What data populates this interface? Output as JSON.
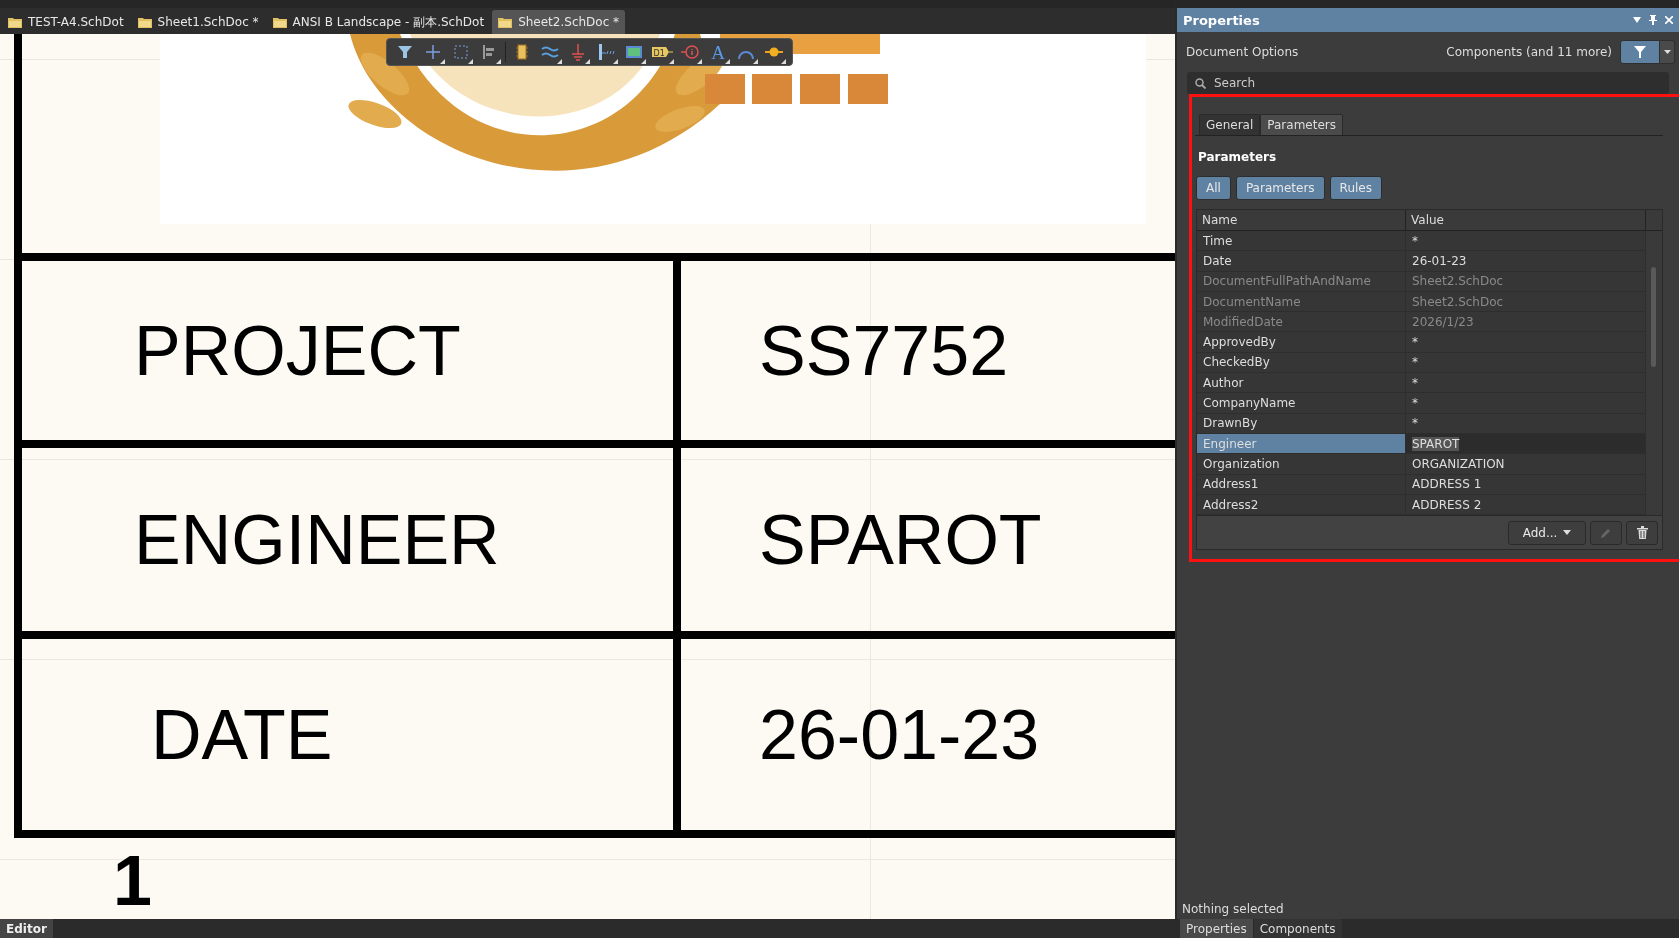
{
  "document_tabs": [
    {
      "label": "TEST-A4.SchDot",
      "selected": false
    },
    {
      "label": "Sheet1.SchDoc *",
      "selected": false
    },
    {
      "label": "ANSI B Landscape - 副本.SchDot",
      "selected": false
    },
    {
      "label": "Sheet2.SchDoc *",
      "selected": true
    }
  ],
  "toolbar": {
    "tag_label": "D1",
    "text_tool_glyph": "A"
  },
  "title_block": {
    "rows": [
      {
        "label": "PROJECT",
        "value": "SS7752"
      },
      {
        "label": "ENGINEER",
        "value": "SPAROT"
      },
      {
        "label": "DATE",
        "value": "26-01-23"
      }
    ],
    "sheet_number": "1"
  },
  "status_bar": {
    "tab": "Editor"
  },
  "properties": {
    "title": "Properties",
    "document_options": "Document Options",
    "filter_label": "Components (and 11 more)",
    "search": {
      "placeholder": "Search"
    },
    "tabs": [
      {
        "label": "General",
        "selected": false
      },
      {
        "label": "Parameters",
        "selected": true
      }
    ],
    "section_title": "Parameters",
    "filter_buttons": [
      "All",
      "Parameters",
      "Rules"
    ],
    "table": {
      "columns": [
        "Name",
        "Value"
      ],
      "rows": [
        {
          "name": "Time",
          "value": "*",
          "selected": false,
          "disabled": false
        },
        {
          "name": "Date",
          "value": "26-01-23",
          "selected": false,
          "disabled": false
        },
        {
          "name": "DocumentFullPathAndName",
          "value": "Sheet2.SchDoc",
          "selected": false,
          "disabled": true
        },
        {
          "name": "DocumentName",
          "value": "Sheet2.SchDoc",
          "selected": false,
          "disabled": true
        },
        {
          "name": "ModifiedDate",
          "value": "2026/1/23",
          "selected": false,
          "disabled": true
        },
        {
          "name": "ApprovedBy",
          "value": "*",
          "selected": false,
          "disabled": false
        },
        {
          "name": "CheckedBy",
          "value": "*",
          "selected": false,
          "disabled": false
        },
        {
          "name": "Author",
          "value": "*",
          "selected": false,
          "disabled": false
        },
        {
          "name": "CompanyName",
          "value": "*",
          "selected": false,
          "disabled": false
        },
        {
          "name": "DrawnBy",
          "value": "*",
          "selected": false,
          "disabled": false
        },
        {
          "name": "Engineer",
          "value": "SPAROT",
          "selected": true,
          "disabled": false
        },
        {
          "name": "Organization",
          "value": "ORGANIZATION",
          "selected": false,
          "disabled": false
        },
        {
          "name": "Address1",
          "value": "ADDRESS 1",
          "selected": false,
          "disabled": false
        },
        {
          "name": "Address2",
          "value": "ADDRESS 2",
          "selected": false,
          "disabled": false
        }
      ]
    },
    "add_button": "Add...",
    "selection_status": "Nothing selected",
    "bottom_tabs": [
      {
        "label": "Properties",
        "selected": true
      },
      {
        "label": "Components",
        "selected": false
      }
    ]
  }
}
